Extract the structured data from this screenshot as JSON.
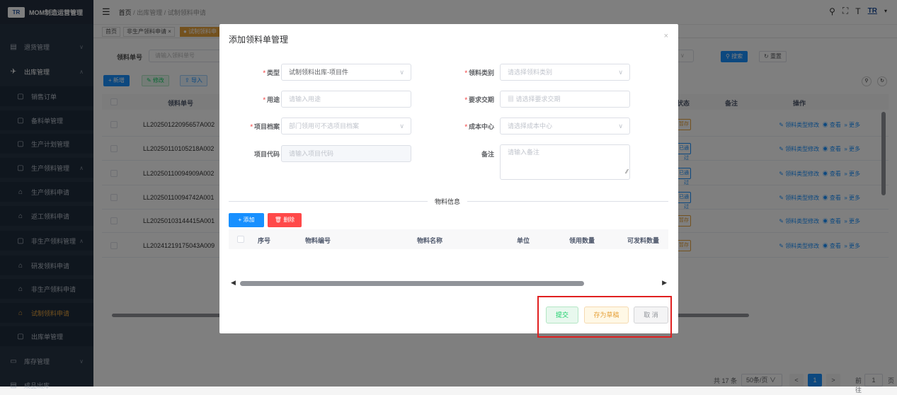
{
  "app": {
    "title": "MOM制造运营管理",
    "logo": "TR"
  },
  "breadcrumb": {
    "home": "首页",
    "level1": "出库管理",
    "level2": "试制领料申请"
  },
  "tabs": {
    "home": "首页",
    "tab1": "非生产领料申请",
    "tab2": "试制领料申"
  },
  "sidebar": {
    "items": [
      {
        "label": "退货管理",
        "icon": "▤",
        "arrow": "∨"
      },
      {
        "label": "出库管理",
        "icon": "✈",
        "arrow": "∧"
      },
      {
        "label": "销售订单",
        "icon": "▢"
      },
      {
        "label": "备料单管理",
        "icon": "▢"
      },
      {
        "label": "生产计划管理",
        "icon": "▢"
      },
      {
        "label": "生产领料管理",
        "icon": "▢",
        "arrow": "∧"
      },
      {
        "label": "生产领料申请",
        "icon": "⌂"
      },
      {
        "label": "返工领料申请",
        "icon": "⌂"
      },
      {
        "label": "非生产领料管理",
        "icon": "▢",
        "arrow": "∧"
      },
      {
        "label": "研发领料申请",
        "icon": "⌂"
      },
      {
        "label": "非生产领料申请",
        "icon": "⌂"
      },
      {
        "label": "试制领料申请",
        "icon": "⌂"
      },
      {
        "label": "出库单管理",
        "icon": "▢"
      },
      {
        "label": "库存管理",
        "icon": "▭",
        "arrow": "∨"
      },
      {
        "label": "成品出库",
        "icon": "▤"
      }
    ]
  },
  "page": {
    "search_label": "领料单号",
    "search_placeholder": "请输入领料单号",
    "search_btn": "搜索",
    "reset_btn": "重置",
    "add_btn": "+ 新增",
    "edit_btn": "修改",
    "import_btn": "导入",
    "columns": {
      "order_no": "领料单号",
      "status": "状态",
      "remark": "备注",
      "ops": "操作"
    },
    "rows": [
      {
        "order_no": "LL20250122095657A002",
        "status": "暂存"
      },
      {
        "order_no": "LL20250110105218A002",
        "status": "已通过"
      },
      {
        "order_no": "LL20250110094909A002",
        "status": "已通过"
      },
      {
        "order_no": "LL20250110094742A001",
        "status": "已通过"
      },
      {
        "order_no": "LL20250103144415A001",
        "status": "暂存"
      },
      {
        "order_no": "LL20241219175043A009",
        "status": "暂存"
      }
    ],
    "op_edit": "领料类型修改",
    "op_view": "查看",
    "op_more": "更多",
    "pager": {
      "total": "共 17 条",
      "size": "50条/页",
      "page": "1",
      "goto": "前往",
      "goto_val": "1",
      "unit": "页"
    }
  },
  "dialog": {
    "title": "添加领料单管理",
    "close": "×",
    "fields": {
      "type_label": "类型",
      "type_value": "试制领料出库-项目件",
      "category_label": "领料类别",
      "category_placeholder": "请选择领料类别",
      "purpose_label": "用途",
      "purpose_placeholder": "请输入用途",
      "delivery_label": "要求交期",
      "delivery_placeholder": "请选择要求交期",
      "project_label": "项目档案",
      "project_placeholder": "部门领用可不选项目档案",
      "cost_label": "成本中心",
      "cost_placeholder": "请选择成本中心",
      "code_label": "项目代码",
      "code_placeholder": "请输入项目代码",
      "remark_label": "备注",
      "remark_placeholder": "请输入备注"
    },
    "section": "物料信息",
    "add_btn": "+ 添加",
    "delete_btn": "删除",
    "columns": [
      "序号",
      "物料编号",
      "物料名称",
      "单位",
      "领用数量",
      "可发料数量"
    ],
    "submit": "提交",
    "draft": "存为草稿",
    "cancel": "取 消"
  }
}
